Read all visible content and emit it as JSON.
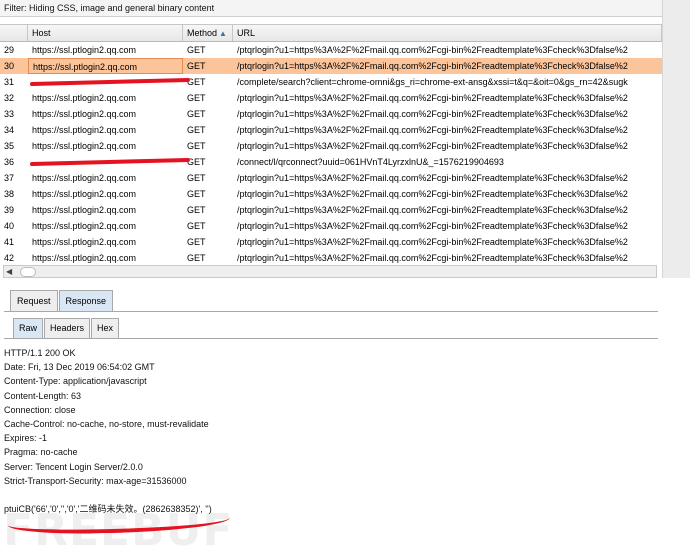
{
  "filter": {
    "text": "Filter: Hiding CSS, image and general binary content"
  },
  "table": {
    "columns": {
      "num": "",
      "host": "Host",
      "method": "Method",
      "url": "URL"
    },
    "sort_indicator": "▲",
    "rows": [
      {
        "num": "29",
        "host": "https://ssl.ptlogin2.qq.com",
        "method": "GET",
        "url": "/ptqrlogin?u1=https%3A%2F%2Fmail.qq.com%2Fcgi-bin%2Freadtemplate%3Fcheck%3Dfalse%2"
      },
      {
        "num": "30",
        "host": "https://ssl.ptlogin2.qq.com",
        "method": "GET",
        "url": "/ptqrlogin?u1=https%3A%2F%2Fmail.qq.com%2Fcgi-bin%2Freadtemplate%3Fcheck%3Dfalse%2",
        "selected": true
      },
      {
        "num": "31",
        "host": "",
        "method": "GET",
        "url": "/complete/search?client=chrome-omni&gs_ri=chrome-ext-ansg&xssi=t&q=&oit=0&gs_rn=42&sugk",
        "redacted": true
      },
      {
        "num": "32",
        "host": "https://ssl.ptlogin2.qq.com",
        "method": "GET",
        "url": "/ptqrlogin?u1=https%3A%2F%2Fmail.qq.com%2Fcgi-bin%2Freadtemplate%3Fcheck%3Dfalse%2"
      },
      {
        "num": "33",
        "host": "https://ssl.ptlogin2.qq.com",
        "method": "GET",
        "url": "/ptqrlogin?u1=https%3A%2F%2Fmail.qq.com%2Fcgi-bin%2Freadtemplate%3Fcheck%3Dfalse%2"
      },
      {
        "num": "34",
        "host": "https://ssl.ptlogin2.qq.com",
        "method": "GET",
        "url": "/ptqrlogin?u1=https%3A%2F%2Fmail.qq.com%2Fcgi-bin%2Freadtemplate%3Fcheck%3Dfalse%2"
      },
      {
        "num": "35",
        "host": "https://ssl.ptlogin2.qq.com",
        "method": "GET",
        "url": "/ptqrlogin?u1=https%3A%2F%2Fmail.qq.com%2Fcgi-bin%2Freadtemplate%3Fcheck%3Dfalse%2"
      },
      {
        "num": "36",
        "host": "",
        "method": "GET",
        "url": "/connect/l/qrconnect?uuid=061HVnT4LyrzxlnU&_=1576219904693",
        "redacted": true
      },
      {
        "num": "37",
        "host": "https://ssl.ptlogin2.qq.com",
        "method": "GET",
        "url": "/ptqrlogin?u1=https%3A%2F%2Fmail.qq.com%2Fcgi-bin%2Freadtemplate%3Fcheck%3Dfalse%2"
      },
      {
        "num": "38",
        "host": "https://ssl.ptlogin2.qq.com",
        "method": "GET",
        "url": "/ptqrlogin?u1=https%3A%2F%2Fmail.qq.com%2Fcgi-bin%2Freadtemplate%3Fcheck%3Dfalse%2"
      },
      {
        "num": "39",
        "host": "https://ssl.ptlogin2.qq.com",
        "method": "GET",
        "url": "/ptqrlogin?u1=https%3A%2F%2Fmail.qq.com%2Fcgi-bin%2Freadtemplate%3Fcheck%3Dfalse%2"
      },
      {
        "num": "40",
        "host": "https://ssl.ptlogin2.qq.com",
        "method": "GET",
        "url": "/ptqrlogin?u1=https%3A%2F%2Fmail.qq.com%2Fcgi-bin%2Freadtemplate%3Fcheck%3Dfalse%2"
      },
      {
        "num": "41",
        "host": "https://ssl.ptlogin2.qq.com",
        "method": "GET",
        "url": "/ptqrlogin?u1=https%3A%2F%2Fmail.qq.com%2Fcgi-bin%2Freadtemplate%3Fcheck%3Dfalse%2"
      },
      {
        "num": "42",
        "host": "https://ssl.ptlogin2.qq.com",
        "method": "GET",
        "url": "/ptqrlogin?u1=https%3A%2F%2Fmail.qq.com%2Fcgi-bin%2Freadtemplate%3Fcheck%3Dfalse%2"
      }
    ]
  },
  "tabs": {
    "request": "Request",
    "response": "Response"
  },
  "subtabs": {
    "raw": "Raw",
    "headers": "Headers",
    "hex": "Hex"
  },
  "response": {
    "headers": [
      "HTTP/1.1 200 OK",
      "Date: Fri, 13 Dec 2019 06:54:02 GMT",
      "Content-Type: application/javascript",
      "Content-Length: 63",
      "Connection: close",
      "Cache-Control: no-cache, no-store, must-revalidate",
      "Expires: -1",
      "Pragma: no-cache",
      "Server: Tencent Login Server/2.0.0",
      "Strict-Transport-Security: max-age=31536000"
    ],
    "body": "ptuiCB('66','0','','0','二维码未失效。(2862638352)', '')"
  },
  "watermark": "FREEBUF",
  "colors": {
    "selected_row": "#fbc49a",
    "redaction": "#e5131f",
    "active_tab": "#d9e7f5"
  },
  "icons": {
    "scroll_left": "left-arrow-icon",
    "sort": "sort-ascending-icon"
  }
}
